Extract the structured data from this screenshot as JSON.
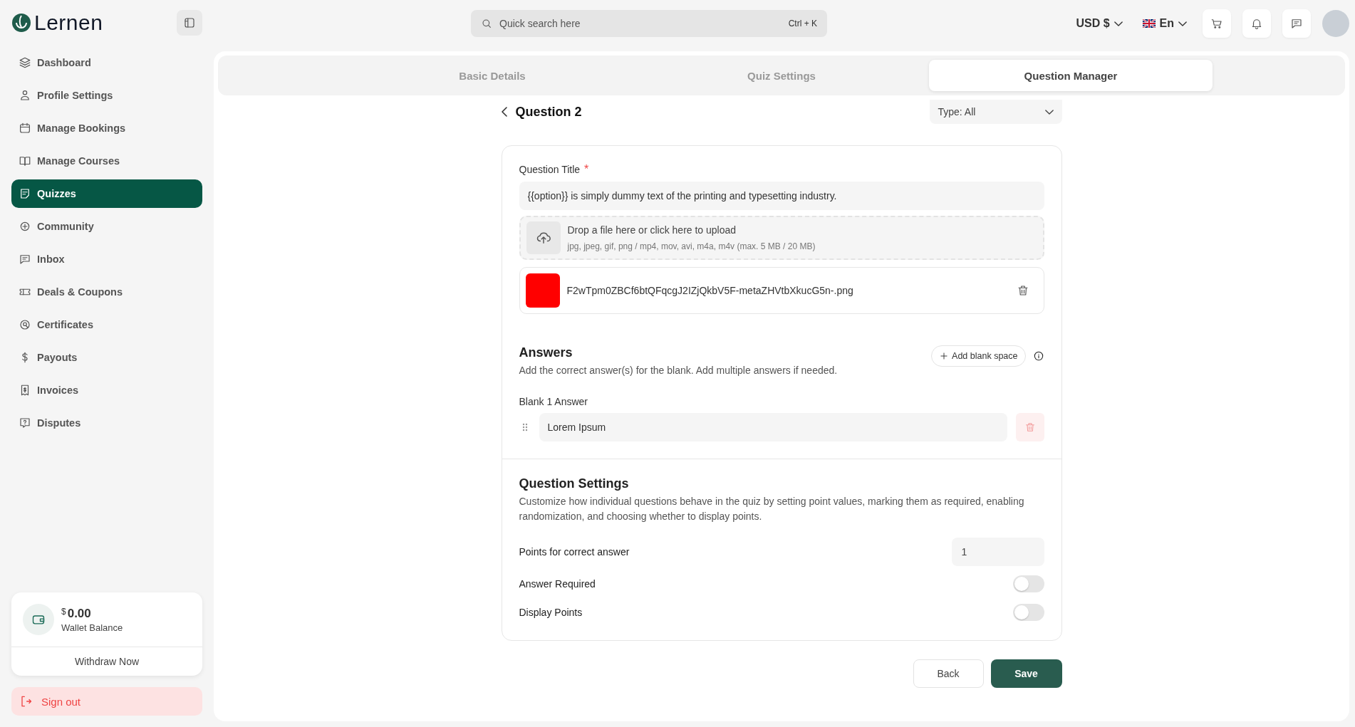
{
  "brand": {
    "name": "Lernen"
  },
  "sidebar": {
    "items": [
      {
        "label": "Dashboard",
        "selected": false
      },
      {
        "label": "Profile Settings",
        "selected": false
      },
      {
        "label": "Manage Bookings",
        "selected": false
      },
      {
        "label": "Manage Courses",
        "selected": false
      },
      {
        "label": "Quizzes",
        "selected": true
      },
      {
        "label": "Community",
        "selected": false
      },
      {
        "label": "Inbox",
        "selected": false
      },
      {
        "label": "Deals & Coupons",
        "selected": false
      },
      {
        "label": "Certificates",
        "selected": false
      },
      {
        "label": "Payouts",
        "selected": false
      },
      {
        "label": "Invoices",
        "selected": false
      },
      {
        "label": "Disputes",
        "selected": false
      }
    ]
  },
  "wallet": {
    "currency": "$",
    "amount": "0.00",
    "label": "Wallet Balance",
    "action": "Withdraw Now"
  },
  "sign_out": "Sign out",
  "search": {
    "placeholder": "Quick search here",
    "shortcut": "Ctrl + K"
  },
  "currency": "USD $",
  "language": "En",
  "tabs": [
    {
      "label": "Basic Details",
      "selected": false
    },
    {
      "label": "Quiz Settings",
      "selected": false
    },
    {
      "label": "Question Manager",
      "selected": true
    }
  ],
  "question": {
    "title": "Question 2",
    "type_filter": "Type: All"
  },
  "question_title": {
    "label": "Question Title",
    "required_mark": "*",
    "value": "{{option}} is simply dummy text of the printing and typesetting industry."
  },
  "upload": {
    "prompt": "Drop a file here or click here to upload",
    "formats": "jpg, jpeg, gif, png / mp4, mov, avi, m4a, m4v (max. 5 MB / 20 MB)"
  },
  "file": {
    "name": "F2wTpm0ZBCf6btQFqcgJ2IZjQkbV5F-metaZHVtbXkucG5n-.png"
  },
  "answers": {
    "title": "Answers",
    "description": "Add the correct answer(s) for the blank. Add multiple answers if needed.",
    "add_button": "Add blank space",
    "blanks": [
      {
        "label": "Blank 1 Answer",
        "value": "Lorem Ipsum"
      }
    ]
  },
  "settings": {
    "title": "Question Settings",
    "description": "Customize how individual questions behave in the quiz by setting point values, marking them as required, enabling randomization, and choosing whether to display points.",
    "rows": [
      {
        "kind": "number",
        "label": "Points for correct answer",
        "value": "1"
      },
      {
        "kind": "toggle",
        "label": "Answer Required",
        "on": false
      },
      {
        "kind": "toggle",
        "label": "Display Points",
        "on": false
      }
    ]
  },
  "buttons": {
    "back": "Back",
    "save": "Save"
  }
}
